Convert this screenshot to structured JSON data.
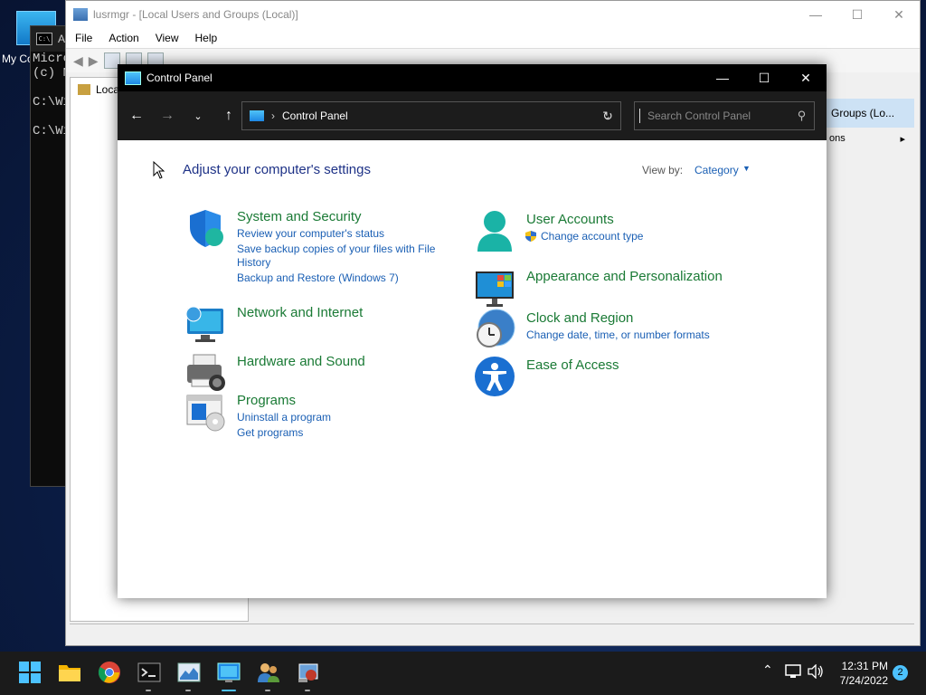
{
  "desktop": {
    "icon_label": "My Co"
  },
  "cmd": {
    "title": "A",
    "lines": [
      "Micro",
      "(c) M",
      "",
      "C:\\Wi",
      "",
      "C:\\Wi"
    ]
  },
  "lusrmgr": {
    "title": "lusrmgr - [Local Users and Groups (Local)]",
    "menu": [
      "File",
      "Action",
      "View",
      "Help"
    ],
    "tree_item": "Local",
    "right_header": "Groups (Lo...",
    "right_row": "ons"
  },
  "control_panel": {
    "title": "Control Panel",
    "address": "Control Panel",
    "search_placeholder": "Search Control Panel",
    "heading": "Adjust your computer's settings",
    "view_by_label": "View by:",
    "view_by_value": "Category",
    "categories": [
      {
        "title": "System and Security",
        "links": [
          "Review your computer's status",
          "Save backup copies of your files with File",
          "History",
          "Backup and Restore (Windows 7)"
        ]
      },
      {
        "title": "Network and Internet",
        "links": []
      },
      {
        "title": "Hardware and Sound",
        "links": []
      },
      {
        "title": "Programs",
        "links": [
          "Uninstall a program",
          "Get programs"
        ]
      },
      {
        "title": "User Accounts",
        "links": [
          "Change account type"
        ]
      },
      {
        "title": "Appearance and Personalization",
        "links": []
      },
      {
        "title": "Clock and Region",
        "links": [
          "Change date, time, or number formats"
        ]
      },
      {
        "title": "Ease of Access",
        "links": []
      }
    ]
  },
  "taskbar": {
    "apps": [
      "start-icon",
      "file-explorer-icon",
      "chrome-icon",
      "terminal-icon",
      "task-manager-icon",
      "control-panel-icon",
      "users-icon",
      "lusrmgr-icon"
    ],
    "time": "12:31 PM",
    "date": "7/24/2022",
    "notifications": "2"
  },
  "colors": {
    "accent": "#4cc2ff",
    "category_title": "#1a7a35",
    "link": "#1a5fb4",
    "heading": "#1e3287"
  }
}
